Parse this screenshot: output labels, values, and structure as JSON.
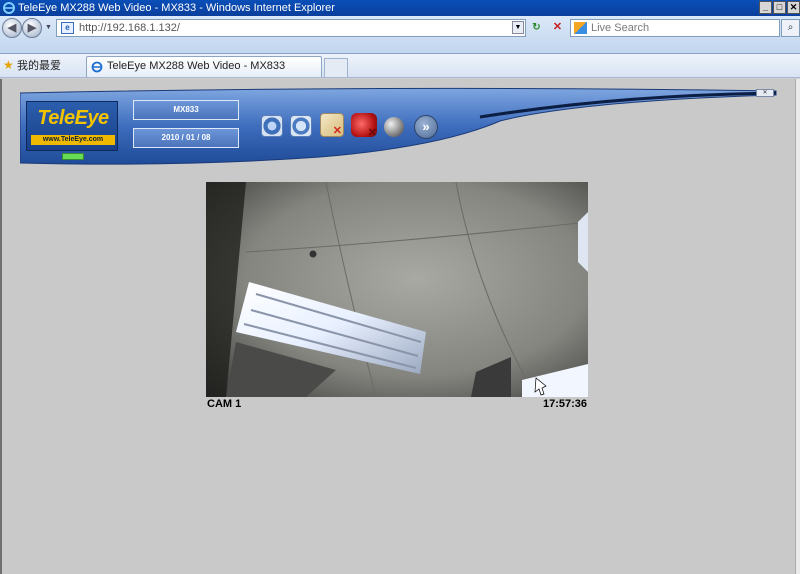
{
  "window": {
    "title": "TeleEye MX288 Web Video - MX833 - Windows Internet Explorer",
    "controls": [
      "_",
      "□",
      "✕"
    ]
  },
  "address_bar": {
    "url": "http://192.168.1.132/",
    "search_placeholder": "Live Search"
  },
  "favorites_bar": {
    "label": "我的最爱",
    "tab_title": "TeleEye MX288 Web Video - MX833"
  },
  "banner": {
    "logo_text": "TeleEye",
    "logo_url": "www.TeleEye.com",
    "model": "MX833",
    "date": "2010 / 01 / 08",
    "close_label": "✕",
    "next_glyph": "»"
  },
  "video": {
    "camera": "CAM  1",
    "timestamp": "17:57:36"
  },
  "colors": {
    "title_bar": "#0a4fb8",
    "banner_blue": "#3e6dbd",
    "logo_yellow": "#f4c400",
    "page_bg": "#c9c9c9"
  }
}
